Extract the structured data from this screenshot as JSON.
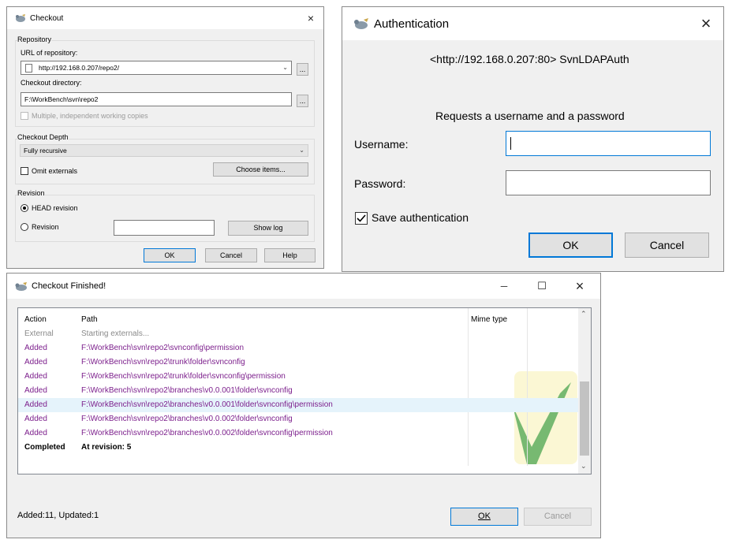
{
  "checkout": {
    "title": "Checkout",
    "close": "×",
    "repository_group": "Repository",
    "url_label": "URL of repository:",
    "url_value": "http://192.168.0.207/repo2/",
    "browse": "...",
    "dir_label": "Checkout directory:",
    "dir_value": "F:\\WorkBench\\svn\\repo2",
    "multiple_label": "Multiple, independent working copies",
    "depth_group": "Checkout Depth",
    "depth_value": "Fully recursive",
    "omit_label": "Omit externals",
    "choose_items": "Choose items...",
    "revision_group": "Revision",
    "head_label": "HEAD revision",
    "revision_label": "Revision",
    "revision_value": "",
    "show_log": "Show log",
    "ok": "OK",
    "cancel": "Cancel",
    "help": "Help"
  },
  "auth": {
    "title": "Authentication",
    "close": "×",
    "realm": "<http://192.168.0.207:80> SvnLDAPAuth",
    "request": "Requests a username and a password",
    "username_label": "Username:",
    "username_value": "",
    "password_label": "Password:",
    "save_label": "Save authentication",
    "save_checked": true,
    "ok": "OK",
    "cancel": "Cancel"
  },
  "finished": {
    "title": "Checkout Finished!",
    "minimize": "─",
    "maximize": "☐",
    "close": "×",
    "columns": [
      "Action",
      "Path",
      "Mime type"
    ],
    "rows": [
      {
        "action": "External",
        "path": "Starting externals..."
      },
      {
        "action": "Added",
        "path": "F:\\WorkBench\\svn\\repo2\\svnconfig\\permission"
      },
      {
        "action": "Added",
        "path": "F:\\WorkBench\\svn\\repo2\\trunk\\folder\\svnconfig"
      },
      {
        "action": "Added",
        "path": "F:\\WorkBench\\svn\\repo2\\trunk\\folder\\svnconfig\\permission"
      },
      {
        "action": "Added",
        "path": "F:\\WorkBench\\svn\\repo2\\branches\\v0.0.001\\folder\\svnconfig"
      },
      {
        "action": "Added",
        "path": "F:\\WorkBench\\svn\\repo2\\branches\\v0.0.001\\folder\\svnconfig\\permission"
      },
      {
        "action": "Added",
        "path": "F:\\WorkBench\\svn\\repo2\\branches\\v0.0.002\\folder\\svnconfig"
      },
      {
        "action": "Added",
        "path": "F:\\WorkBench\\svn\\repo2\\branches\\v0.0.002\\folder\\svnconfig\\permission"
      },
      {
        "action": "Completed",
        "path": "At revision: 5"
      }
    ],
    "status": "Added:11, Updated:1",
    "ok": "OK",
    "cancel": "Cancel"
  },
  "colors": {
    "added": "#7c1f8c",
    "selection": "#e5f3fb",
    "accent": "#0078d7"
  },
  "icons": {
    "app": "tortoise-icon",
    "combo": "chevron-down-icon",
    "scroll_up": "chevron-up-icon",
    "scroll_down": "chevron-down-icon",
    "status_watermark": "checkmark-icon"
  }
}
